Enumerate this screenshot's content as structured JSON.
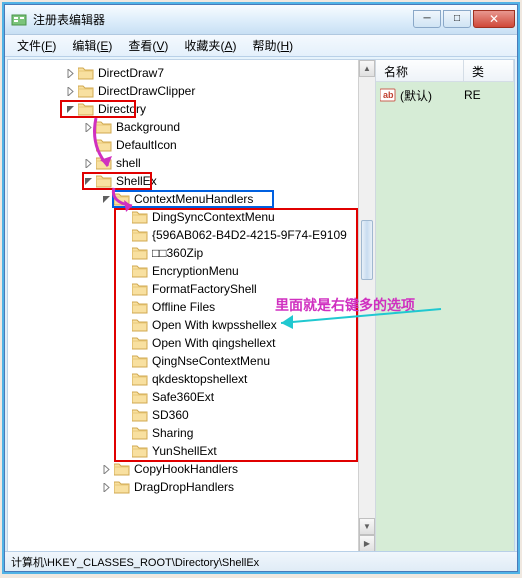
{
  "window": {
    "title": "注册表编辑器"
  },
  "menu": {
    "file": "文件",
    "file_key": "F",
    "edit": "编辑",
    "edit_key": "E",
    "view": "查看",
    "view_key": "V",
    "fav": "收藏夹",
    "fav_key": "A",
    "help": "帮助",
    "help_key": "H"
  },
  "tree": [
    {
      "indent": 3,
      "exp": "closed",
      "label": "DirectDraw7"
    },
    {
      "indent": 3,
      "exp": "closed",
      "label": "DirectDrawClipper"
    },
    {
      "indent": 3,
      "exp": "open",
      "label": "Directory",
      "red": true
    },
    {
      "indent": 4,
      "exp": "closed",
      "label": "Background"
    },
    {
      "indent": 4,
      "exp": "none",
      "label": "DefaultIcon"
    },
    {
      "indent": 4,
      "exp": "closed",
      "label": "shell"
    },
    {
      "indent": 4,
      "exp": "open",
      "label": "ShellEx",
      "red": true
    },
    {
      "indent": 5,
      "exp": "open",
      "label": "ContextMenuHandlers",
      "blue": true
    },
    {
      "indent": 6,
      "exp": "none",
      "label": "DingSyncContextMenu"
    },
    {
      "indent": 6,
      "exp": "none",
      "label": "{596AB062-B4D2-4215-9F74-E9109"
    },
    {
      "indent": 6,
      "exp": "none",
      "label": "□□360Zip"
    },
    {
      "indent": 6,
      "exp": "none",
      "label": "EncryptionMenu"
    },
    {
      "indent": 6,
      "exp": "none",
      "label": "FormatFactoryShell"
    },
    {
      "indent": 6,
      "exp": "none",
      "label": "Offline Files"
    },
    {
      "indent": 6,
      "exp": "none",
      "label": "Open With kwpsshellex"
    },
    {
      "indent": 6,
      "exp": "none",
      "label": "Open With qingshellext"
    },
    {
      "indent": 6,
      "exp": "none",
      "label": "QingNseContextMenu"
    },
    {
      "indent": 6,
      "exp": "none",
      "label": "qkdesktopshellext"
    },
    {
      "indent": 6,
      "exp": "none",
      "label": "Safe360Ext"
    },
    {
      "indent": 6,
      "exp": "none",
      "label": "SD360"
    },
    {
      "indent": 6,
      "exp": "none",
      "label": "Sharing"
    },
    {
      "indent": 6,
      "exp": "none",
      "label": "YunShellExt"
    },
    {
      "indent": 5,
      "exp": "closed",
      "label": "CopyHookHandlers"
    },
    {
      "indent": 5,
      "exp": "closed",
      "label": "DragDropHandlers"
    }
  ],
  "list": {
    "col_name": "名称",
    "col_type": "类",
    "default_label": "(默认)",
    "default_type": "RE"
  },
  "annotation": "里面就是右键多的选项",
  "statusbar": "计算机\\HKEY_CLASSES_ROOT\\Directory\\ShellEx"
}
